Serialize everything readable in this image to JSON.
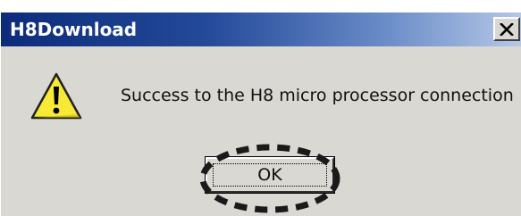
{
  "window": {
    "title": "H8Download"
  },
  "dialog": {
    "icon": "warning-icon",
    "message": "Success to the H8 micro processor connection",
    "ok_label": "OK"
  },
  "colors": {
    "titlebar_start": "#0b2c7a",
    "titlebar_end": "#b6c8e8",
    "dialog_bg": "#d9d8d3",
    "warning_yellow": "#f7e935"
  },
  "annotation": {
    "highlight": "dashed-ellipse-around-ok-button"
  }
}
